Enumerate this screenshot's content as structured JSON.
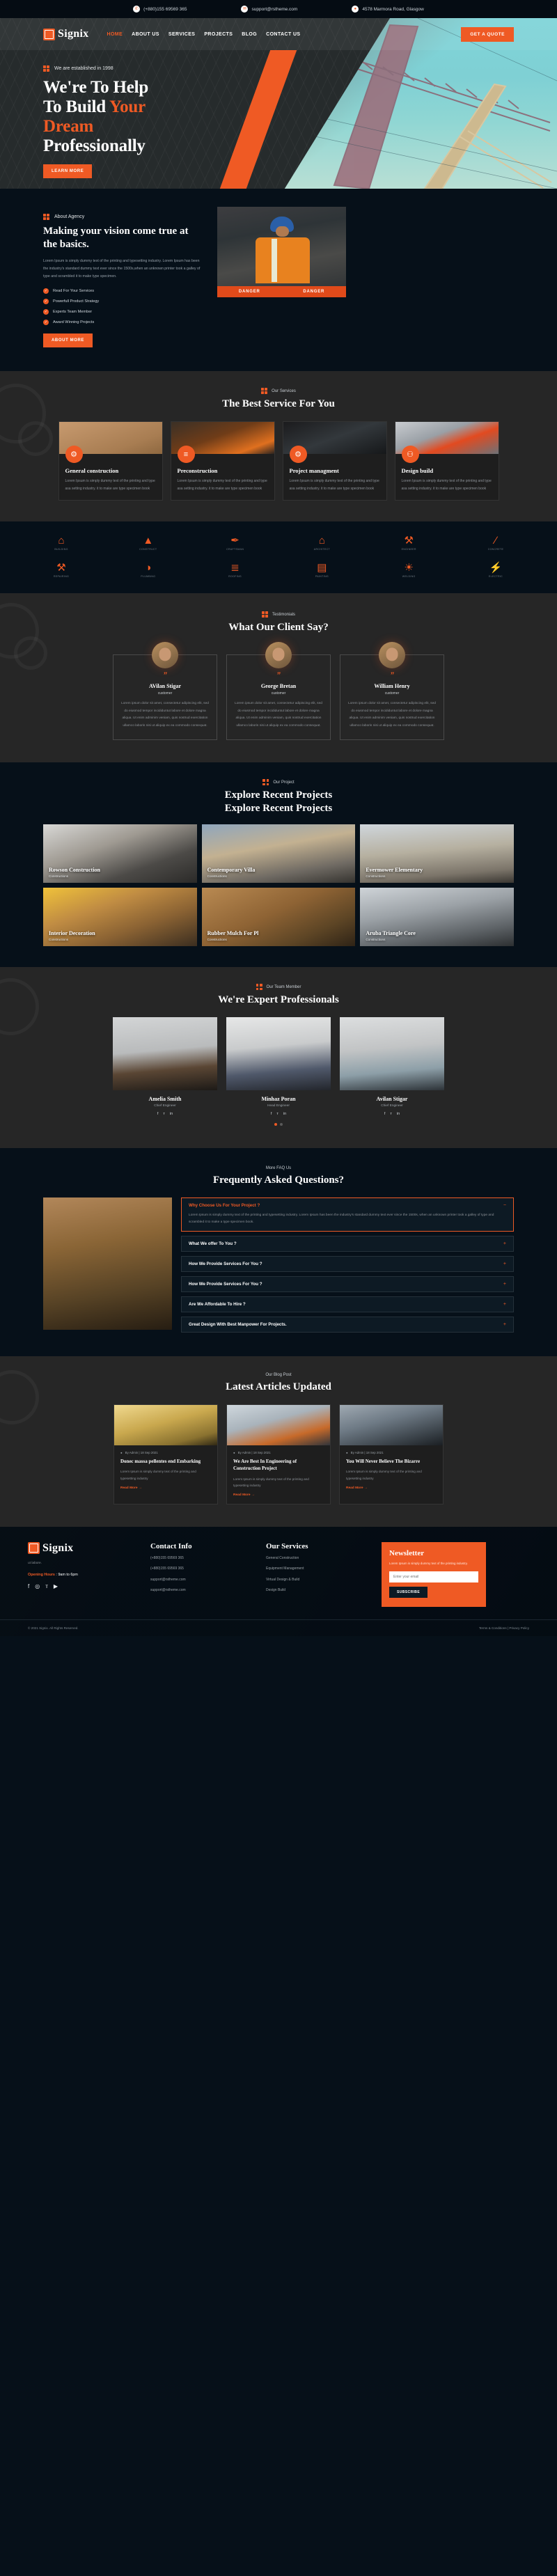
{
  "topbar": {
    "phone": "(+880)155 69569 365",
    "email": "support@rstheme.com",
    "address": "4578 Marmora Road, Glasgow"
  },
  "brand": {
    "name": "Signix",
    "accent": "#ef5a24"
  },
  "nav": {
    "items": [
      "HOME",
      "ABOUT US",
      "SERVICES",
      "PROJECTS",
      "BLOG",
      "CONTACT US"
    ],
    "active": "HOME",
    "cta": "GET A QUOTE"
  },
  "hero": {
    "eyebrow": "We are established in 1998",
    "title_l1": "We're To Help",
    "title_l2a": "To Build ",
    "title_l2b": "Your",
    "title_l3": "Dream",
    "title_l4": "Professionally",
    "cta": "LEARN MORE"
  },
  "about": {
    "eyebrow": "About Agency",
    "title": "Making your vision come true at the basics.",
    "text": "Lorem Ipsum is simply dummy text of the printing and typesetting industry. Lorem Ipsum has been the industry's standard dummy text ever since the 1500s,when an unknown printer took a galley of type and scrambled it to make type specimen.",
    "checks": [
      "Read For Your Services",
      "Powerfull Product Strategy",
      "Experts Team Member",
      "Award Winning Projects"
    ],
    "cta": "ABOUT MORE",
    "image_caption_left": "DANGER",
    "image_caption_right": "DANGER"
  },
  "services": {
    "eyebrow": "Our Services",
    "title": "The Best Service For You",
    "cards": [
      {
        "icon": "document-gear-icon",
        "glyph": "⚙",
        "title": "General construction",
        "text": "Lorem Ipsum is simply dummy text of the printing and type asa setting industry. it to make are type specimen book"
      },
      {
        "icon": "sliders-icon",
        "glyph": "≡",
        "title": "Preconstruction",
        "text": "Lorem Ipsum is simply dummy text of the printing and type asa setting industry. it to make are type specimen book"
      },
      {
        "icon": "document-gear-icon",
        "glyph": "⚙",
        "title": "Project managment",
        "text": "Lorem Ipsum is simply dummy text of the printing and type asa setting industry. it to make are type specimen book"
      },
      {
        "icon": "circles-icon",
        "glyph": "⚇",
        "title": "Design build",
        "text": "Lorem Ipsum is simply dummy text of the printing and type asa setting industry. it to make are type specimen book"
      }
    ]
  },
  "brands": {
    "row1": [
      {
        "glyph": "⌂",
        "name": "BUILDING"
      },
      {
        "glyph": "▲",
        "name": "CONSTRUCT"
      },
      {
        "glyph": "✒",
        "name": "CRAFTSMAN"
      },
      {
        "glyph": "⌂",
        "name": "ARCHITECT"
      },
      {
        "glyph": "⚒",
        "name": "ENGINEER"
      },
      {
        "glyph": "∕",
        "name": "CONCRETE"
      }
    ],
    "row2": [
      {
        "glyph": "⚒",
        "name": "REPAIRING"
      },
      {
        "glyph": "◑",
        "name": "PLUMBING"
      },
      {
        "glyph": "≣",
        "name": "ROOFING"
      },
      {
        "glyph": "▤",
        "name": "PAINTING"
      },
      {
        "glyph": "☀",
        "name": "WELDING"
      },
      {
        "glyph": "⚡",
        "name": "ELECTRIC"
      }
    ]
  },
  "testimonials": {
    "eyebrow": "Testimonials",
    "title": "What Our Client Say?",
    "items": [
      {
        "name": "AVilan Stigar",
        "role": "customer",
        "quote": "Lorem ipsum dolor sit amet, consectetur adipiscing elit, sed do eiusmod tempor incididuntut labore et dolore magna aliqua. Ut enim adminim veniam, quis nostrud exercitation ullamco laboris nisi ut aliquip ex ea commodo consequat."
      },
      {
        "name": "George Bretan",
        "role": "customer",
        "quote": "Lorem ipsum dolor sit amet, consectetur adipiscing elit, sed do eiusmod tempor incididuntut labore et dolore magna aliqua. Ut enim adminim veniam, quis nostrud exercitation ullamco laboris nisi ut aliquip ex ea commodo consequat."
      },
      {
        "name": "William Henry",
        "role": "customer",
        "quote": "Lorem ipsum dolor sit amet, consectetur adipiscing elit, sed do eiusmod tempor incididuntut labore et dolore magna aliqua. Ut enim adminim veniam, quis nostrud exercitation ullamco laboris nisi ut aliquip ex ea commodo consequat."
      }
    ]
  },
  "projects": {
    "eyebrow": "Our Project",
    "title": "Explore Recent Projects",
    "title2": "Explore Recent Projects",
    "items": [
      {
        "title": "Rowson Construction",
        "sub": "Constructions"
      },
      {
        "title": "Contemporary Villa",
        "sub": "Constructions"
      },
      {
        "title": "Evermower Elementary",
        "sub": "Constructions"
      },
      {
        "title": "Interior Decoration",
        "sub": "Constructions"
      },
      {
        "title": "Rubber Mulch For Pl",
        "sub": "Constructions"
      },
      {
        "title": "Aruba Triangle Core",
        "sub": "Constructions"
      }
    ]
  },
  "team": {
    "eyebrow": "Our Team Member",
    "title": "We're Expert Professionals",
    "members": [
      {
        "name": "Amelia Smith",
        "role": "Chief Engineer"
      },
      {
        "name": "Minhaz Poran",
        "role": "Head Engineer"
      },
      {
        "name": "Avilan Stigar",
        "role": "Chief Engineer"
      }
    ],
    "socials": [
      "f",
      "ᴛ",
      "in"
    ]
  },
  "faq": {
    "eyebrow": "More FAQ Us",
    "title": "Frequently Asked Questions?",
    "items": [
      {
        "q": "Why Choose Us For Your Project ?",
        "a": "Lorem Ipsum is simply dummy text of the printing and typesetting industry. Lorem Ipsum has been the industry's standard dummy text ever since the 1500s, when an unknown printer took a galley of type and scrambled it to make a type specimen book.",
        "open": true
      },
      {
        "q": "What We offer To You ?",
        "a": "",
        "open": false
      },
      {
        "q": "How We Provide Services For You ?",
        "a": "",
        "open": false
      },
      {
        "q": "How We Provide Services For You ?",
        "a": "",
        "open": false
      },
      {
        "q": "Are We Affordable To Hire ?",
        "a": "",
        "open": false
      },
      {
        "q": "Great Design With Best Manpower For Projects.",
        "a": "",
        "open": false
      }
    ]
  },
  "blog": {
    "eyebrow": "Our Blog Post",
    "title": "Latest Articles Updated",
    "posts": [
      {
        "meta": "By Admin | 18 Sep 2021",
        "title": "Donec massa pellentes end Embarking",
        "text": "Lorem Ipsum is simply dummy text of the printing and typesetting industry",
        "more": "Read More →"
      },
      {
        "meta": "By Admin | 18 Sep 2021",
        "title": "We Are Best In Engineering of Construction Project",
        "text": "Lorem Ipsum is simply dummy text of the printing and typesetting industry",
        "more": "Read More →"
      },
      {
        "meta": "By Admin | 18 Sep 2021",
        "title": "You Will Never Believe The Bizarre",
        "text": "Lorem Ipsum is simply dummy text of the printing and typesetting industry",
        "more": "Read More →"
      }
    ]
  },
  "footer": {
    "about_text": "ut labore.",
    "hours_label": "Opening Hours",
    "hours_value": "9am to 6pm",
    "socials": [
      "f",
      "◎",
      "ᴛ",
      "▶"
    ],
    "contact_title": "Contact Info",
    "contact_lines": [
      "(+880)155 69569 365",
      "(+880)155 69569 365",
      "support@rstheme.com",
      "support@rstheme.com"
    ],
    "services_title": "Our Services",
    "services": [
      "General Construction",
      "Equipment Management",
      "Virtual Design & Build",
      "Design Build"
    ],
    "newsletter_title": "Newsletter",
    "newsletter_text": "Lorem Ipsum is simply dummy text of the printing industry.",
    "newsletter_placeholder": "Enter your email",
    "newsletter_btn": "SUBSCRIBE",
    "copyright": "© 2021 Signix. All Rights Reserved.",
    "links": "Terms & Conditions  |  Privacy Policy"
  }
}
